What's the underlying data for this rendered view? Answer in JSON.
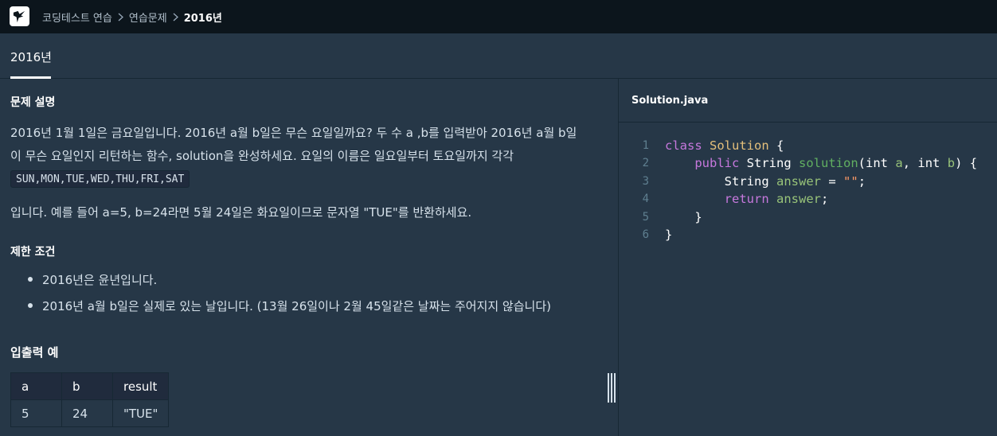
{
  "breadcrumb": [
    "코딩테스트 연습",
    "연습문제",
    "2016년"
  ],
  "title": "2016년",
  "description": {
    "heading": "문제 설명",
    "line1": "2016년 1월 1일은 금요일입니다. 2016년 a월 b일은 무슨 요일일까요? 두 수 a ,b를 입력받아 2016년 a월 b일",
    "line2": "이 무슨 요일인지 리턴하는 함수, solution을 완성하세요. 요일의 이름은 일요일부터 토요일까지 각각",
    "code": "SUN,MON,TUE,WED,THU,FRI,SAT",
    "line3": "입니다. 예를 들어 a=5, b=24라면 5월 24일은 화요일이므로 문자열 \"TUE\"를 반환하세요."
  },
  "constraints": {
    "heading": "제한 조건",
    "items": [
      "2016년은 윤년입니다.",
      "2016년 a월 b일은 실제로 있는 날입니다. (13월 26일이나 2월 45일같은 날짜는 주어지지 않습니다)"
    ]
  },
  "io_example": {
    "heading": "입출력 예",
    "columns": [
      "a",
      "b",
      "result"
    ],
    "rows": [
      [
        "5",
        "24",
        "\"TUE\""
      ]
    ]
  },
  "editor": {
    "file_name": "Solution.java",
    "line_numbers": [
      "1",
      "2",
      "3",
      "4",
      "5",
      "6"
    ],
    "code": {
      "l1_kw": "class",
      "l1_cls": "Solution",
      "l1_brace": "{",
      "l2_kw": "public",
      "l2_type": "String",
      "l2_fn": "solution",
      "l2_open": "(",
      "l2_t1": "int",
      "l2_p1": "a",
      "l2_comma": ",",
      "l2_t2": "int",
      "l2_p2": "b",
      "l2_close": ") {",
      "l3_type": "String",
      "l3_var": "answer",
      "l3_eq": "=",
      "l3_str": "\"\"",
      "l3_semi": ";",
      "l4_kw": "return",
      "l4_var": "answer",
      "l4_semi": ";",
      "l5": "}",
      "l6": "}"
    }
  },
  "colors": {
    "background": "#263747",
    "topbar": "#0c151c",
    "keyword": "#c678dd",
    "class_name": "#e5c07b",
    "function": "#61af61",
    "param": "#98c379",
    "string": "#ff9966"
  }
}
